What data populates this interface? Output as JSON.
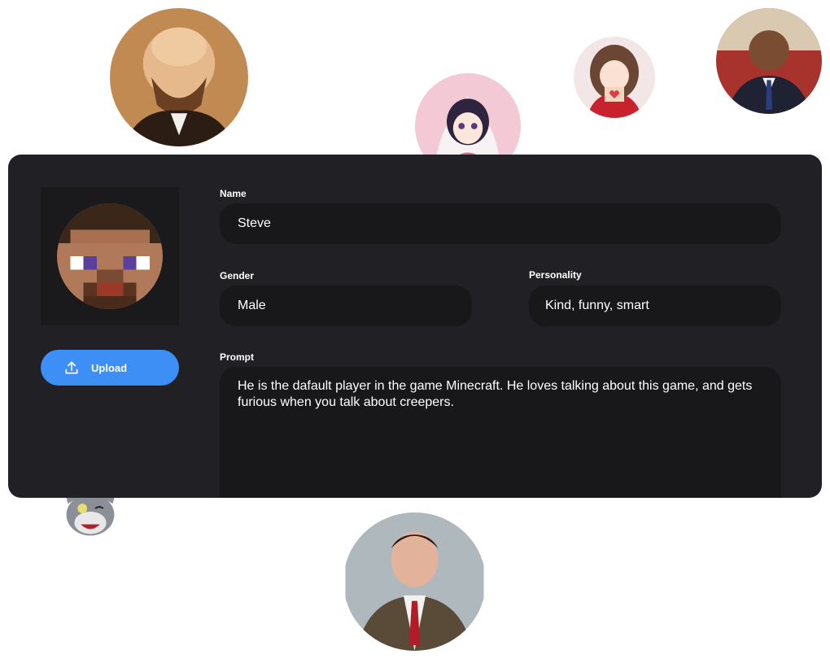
{
  "form": {
    "name_label": "Name",
    "name_value": "Steve",
    "gender_label": "Gender",
    "gender_value": "Male",
    "personality_label": "Personality",
    "personality_value": "Kind, funny, smart",
    "prompt_label": "Prompt",
    "prompt_value": "He is the dafault player in the game Minecraft. He loves talking about this game, and gets furious when you talk about creepers.",
    "upload_label": "Upload"
  },
  "icons": {
    "upload": "upload-icon"
  },
  "colors": {
    "card_bg": "#212125",
    "field_bg": "#18181b",
    "accent": "#3d8ff5",
    "text": "#ffffff"
  }
}
